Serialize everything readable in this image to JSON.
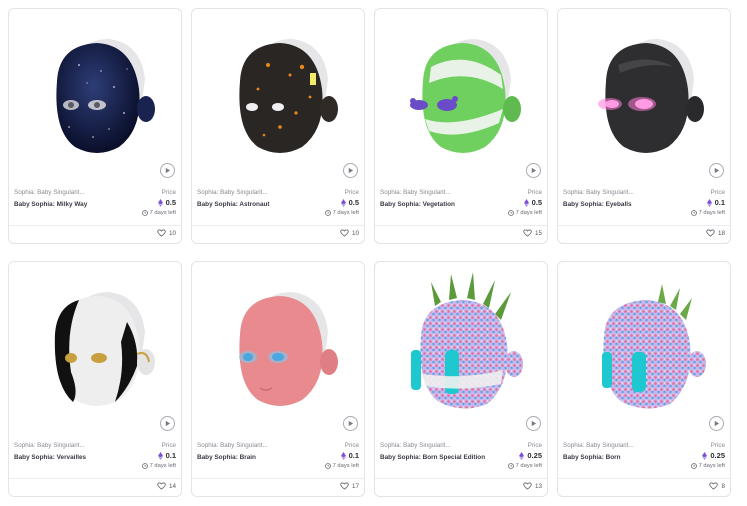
{
  "cards": [
    {
      "collection": "Sophia: Baby Singularit...",
      "name": "Baby Sophia: Milky Way",
      "price_label": "Price",
      "price": "0.5",
      "time_left": "7 days left",
      "likes": "10",
      "theme": "milky-way"
    },
    {
      "collection": "Sophia: Baby Singularit...",
      "name": "Baby Sophia: Astronaut",
      "price_label": "Price",
      "price": "0.5",
      "time_left": "7 days left",
      "likes": "10",
      "theme": "astronaut"
    },
    {
      "collection": "Sophia: Baby Singularit...",
      "name": "Baby Sophia: Vegetation",
      "price_label": "Price",
      "price": "0.5",
      "time_left": "7 days left",
      "likes": "15",
      "theme": "vegetation"
    },
    {
      "collection": "Sophia: Baby Singularit...",
      "name": "Baby Sophia: Eyeballs",
      "price_label": "Price",
      "price": "0.1",
      "time_left": "7 days left",
      "likes": "18",
      "theme": "eyeballs"
    },
    {
      "collection": "Sophia: Baby Singularit...",
      "name": "Baby Sophia: Vervailles",
      "price_label": "Price",
      "price": "0.1",
      "time_left": "7 days left",
      "likes": "14",
      "theme": "vervailles"
    },
    {
      "collection": "Sophia: Baby Singularit...",
      "name": "Baby Sophia: Brain",
      "price_label": "Price",
      "price": "0.1",
      "time_left": "7 days left",
      "likes": "17",
      "theme": "brain"
    },
    {
      "collection": "Sophia: Baby Singularit...",
      "name": "Baby Sophia: Born Special Edition",
      "price_label": "Price",
      "price": "0.25",
      "time_left": "7 days left",
      "likes": "13",
      "theme": "born-special"
    },
    {
      "collection": "Sophia: Baby Singularit...",
      "name": "Baby Sophia: Born",
      "price_label": "Price",
      "price": "0.25",
      "time_left": "7 days left",
      "likes": "8",
      "theme": "born"
    }
  ],
  "colors": {
    "eth_top": "#7b4fd6",
    "eth_bottom": "#a98ae8",
    "border": "#e4e4e8"
  },
  "icons": {
    "play": "play-icon",
    "currency": "ethereum-icon",
    "clock": "clock-icon",
    "like": "heart-icon"
  }
}
